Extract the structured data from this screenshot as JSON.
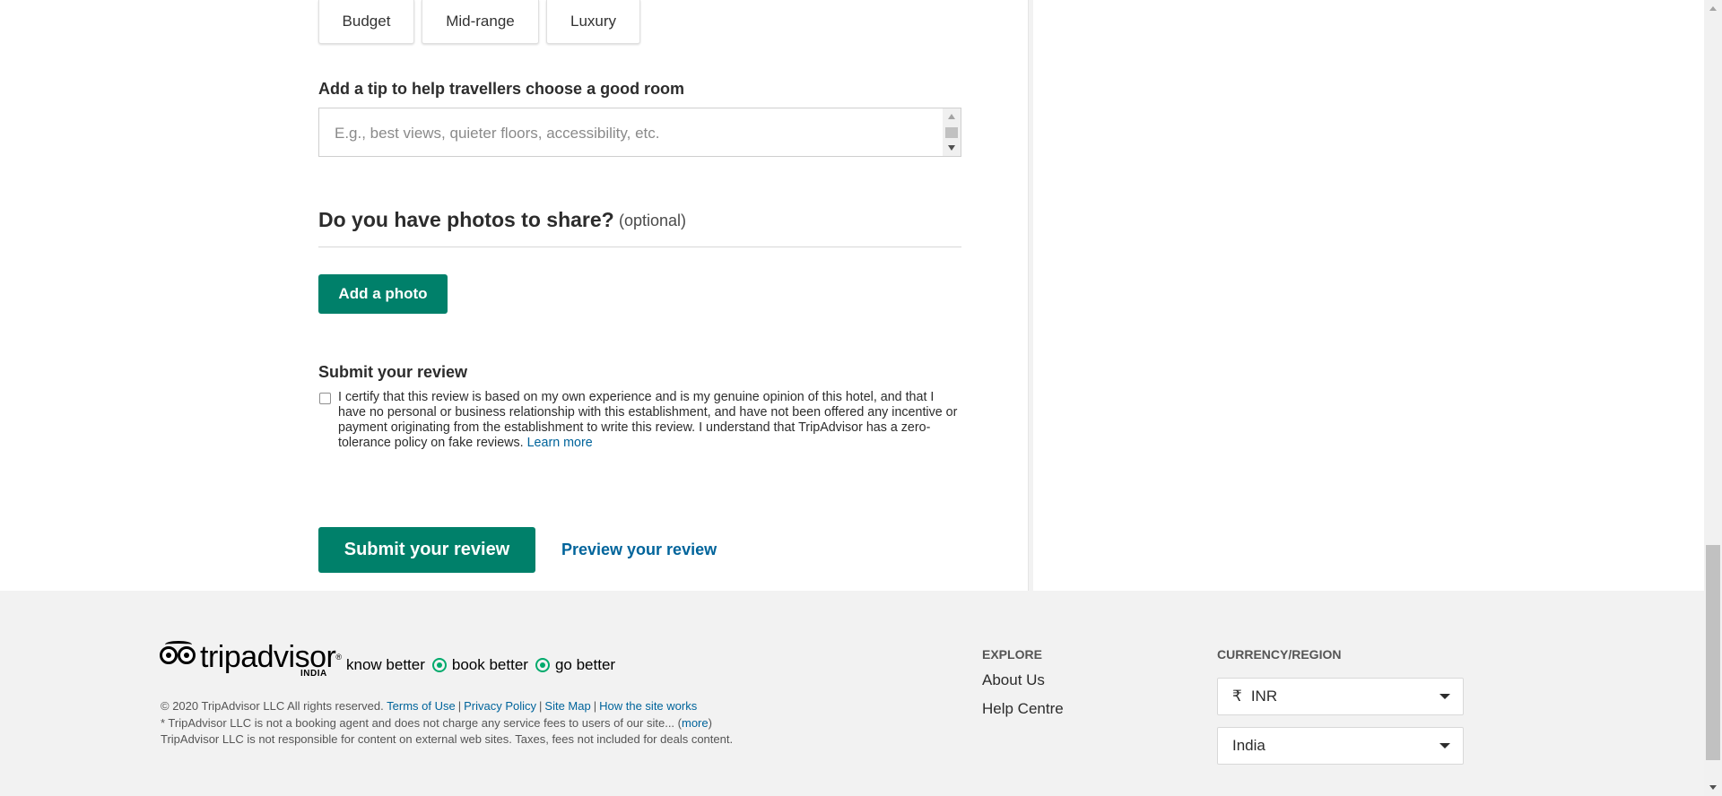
{
  "price_range": {
    "options": [
      "Budget",
      "Mid-range",
      "Luxury"
    ]
  },
  "room_tip": {
    "label": "Add a tip to help travellers choose a good room",
    "placeholder": "E.g., best views, quieter floors, accessibility, etc."
  },
  "photos": {
    "heading": "Do you have photos to share?",
    "optional": "(optional)",
    "add_button": "Add a photo"
  },
  "submit_section": {
    "heading": "Submit your review",
    "certify_text": "I certify that this review is based on my own experience and is my genuine opinion of this hotel, and that I have no personal or business relationship with this establishment, and have not been offered any incentive or payment originating from the establishment to write this review. I understand that TripAdvisor has a zero-tolerance policy on fake reviews.",
    "learn_more": "Learn more",
    "certified": false,
    "submit_button": "Submit your review",
    "preview_link": "Preview your review"
  },
  "footer": {
    "logo_word": "tripadvisor",
    "logo_region": "INDIA",
    "tagline": [
      "know better",
      "book better",
      "go better"
    ],
    "copyright": "© 2020 TripAdvisor LLC All rights reserved.",
    "legal_links": [
      "Terms of Use",
      "Privacy Policy",
      "Site Map",
      "How the site works"
    ],
    "disclaimer_1": "* TripAdvisor LLC is not a booking agent and does not charge any service fees to users of our site... (",
    "more_link": "more",
    "disclaimer_1_end": ")",
    "disclaimer_2": "TripAdvisor LLC is not responsible for content on external web sites. Taxes, fees not included for deals content.",
    "explore": {
      "heading": "EXPLORE",
      "links": [
        "About Us",
        "Help Centre"
      ]
    },
    "currency_region": {
      "heading": "CURRENCY/REGION",
      "currency_symbol": "₹",
      "currency": "INR",
      "region": "India"
    }
  },
  "colors": {
    "brand_green": "#00806a",
    "link_blue": "#00649b",
    "logo_accent": "#00aa6c"
  }
}
